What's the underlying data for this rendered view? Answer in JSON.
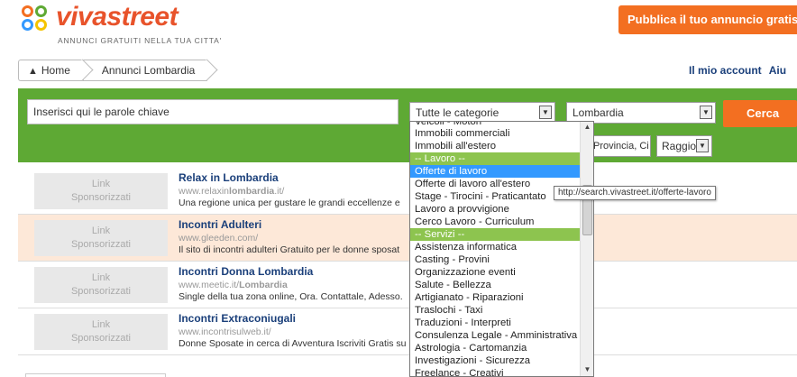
{
  "header": {
    "brand_name": "vivastreet",
    "tagline": "ANNUNCI GRATUITI NELLA TUA CITTA'",
    "publish_button": "Pubblica il tuo annuncio gratis"
  },
  "breadcrumb": {
    "home": "Home",
    "current": "Annunci Lombardia"
  },
  "account": {
    "my_account": "Il mio account",
    "help": "Aiu"
  },
  "search": {
    "keyword_placeholder": "Inserisci qui le parole chiave",
    "category_selected": "Tutte le categorie",
    "region_selected": "Lombardia",
    "search_button": "Cerca",
    "province_text": "Provincia, Ci",
    "radius_selected": "Raggio"
  },
  "dropdown": {
    "partial_top": "Veicoli - Motori",
    "items": [
      {
        "label": "Immobili commerciali",
        "type": "option"
      },
      {
        "label": "Immobili all'estero",
        "type": "option"
      },
      {
        "label": "-- Lavoro --",
        "type": "group"
      },
      {
        "label": "Offerte di lavoro",
        "type": "selected"
      },
      {
        "label": "Offerte di lavoro all'estero",
        "type": "option"
      },
      {
        "label": "Stage - Tirocini - Praticantato",
        "type": "option"
      },
      {
        "label": "Lavoro a provvigione",
        "type": "option"
      },
      {
        "label": "Cerco Lavoro - Curriculum",
        "type": "option"
      },
      {
        "label": "-- Servizi --",
        "type": "group"
      },
      {
        "label": "Assistenza informatica",
        "type": "option"
      },
      {
        "label": "Casting - Provini",
        "type": "option"
      },
      {
        "label": "Organizzazione eventi",
        "type": "option"
      },
      {
        "label": "Salute - Bellezza",
        "type": "option"
      },
      {
        "label": "Artigianato - Riparazioni",
        "type": "option"
      },
      {
        "label": "Traslochi - Taxi",
        "type": "option"
      },
      {
        "label": "Traduzioni - Interpreti",
        "type": "option"
      },
      {
        "label": "Consulenza Legale - Amministrativa",
        "type": "option"
      },
      {
        "label": "Astrologia - Cartomanzia",
        "type": "option"
      },
      {
        "label": "Investigazioni - Sicurezza",
        "type": "option"
      },
      {
        "label": "Freelance - Creativi",
        "type": "option"
      }
    ]
  },
  "tooltip": "http://search.vivastreet.it/offerte-lavoro",
  "ads": [
    {
      "sponsor_line1": "Link",
      "sponsor_line2": "Sponsorizzati",
      "title": "Relax in Lombardia",
      "url_pre": "www.relaxin",
      "url_bold": "lombardia",
      "url_post": ".it/",
      "desc": "Una regione unica per gustare le grandi eccellenze e",
      "highlight": false
    },
    {
      "sponsor_line1": "Link",
      "sponsor_line2": "Sponsorizzati",
      "title": "Incontri Adulteri",
      "url_pre": "www.gleeden.com/",
      "url_bold": "",
      "url_post": "",
      "desc": "Il sito di incontri adulteri Gratuito per le donne sposat",
      "highlight": true
    },
    {
      "sponsor_line1": "Link",
      "sponsor_line2": "Sponsorizzati",
      "title": "Incontri Donna Lombardia",
      "url_pre": "www.meetic.it/",
      "url_bold": "Lombardia",
      "url_post": "",
      "desc": "Single della tua zona online, Ora. Contattale, Adesso.",
      "highlight": false
    },
    {
      "sponsor_line1": "Link",
      "sponsor_line2": "Sponsorizzati",
      "title": "Incontri Extraconiugali",
      "url_pre": "www.incontrisulweb.it/",
      "url_bold": "",
      "url_post": "",
      "desc": "Donne Sposate in cerca di Avventura Iscriviti Gratis su",
      "highlight": false
    }
  ],
  "colors": {
    "brand_orange": "#f36f21",
    "search_green": "#5ea934",
    "group_green": "#8dc44f",
    "selected_blue": "#3399ff",
    "link_blue": "#1a3f7a"
  }
}
